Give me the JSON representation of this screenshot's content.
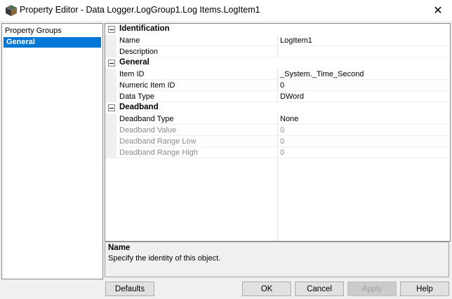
{
  "window": {
    "title": "Property Editor - Data Logger.LogGroup1.Log Items.LogItem1",
    "close_glyph": "✕"
  },
  "groups": {
    "header": "Property Groups",
    "selected": "General"
  },
  "grid": {
    "categories": [
      {
        "label": "Identification",
        "rows": [
          {
            "name": "Name",
            "value": "LogItem1",
            "disabled": false
          },
          {
            "name": "Description",
            "value": "",
            "disabled": false
          }
        ]
      },
      {
        "label": "General",
        "rows": [
          {
            "name": "Item ID",
            "value": "_System._Time_Second",
            "disabled": false
          },
          {
            "name": "Numeric Item ID",
            "value": "0",
            "disabled": false
          },
          {
            "name": "Data Type",
            "value": "DWord",
            "disabled": false
          }
        ]
      },
      {
        "label": "Deadband",
        "rows": [
          {
            "name": "Deadband Type",
            "value": "None",
            "disabled": false
          },
          {
            "name": "Deadband Value",
            "value": "0",
            "disabled": true
          },
          {
            "name": "Deadband Range Low",
            "value": "0",
            "disabled": true
          },
          {
            "name": "Deadband Range High",
            "value": "0",
            "disabled": true
          }
        ]
      }
    ]
  },
  "help": {
    "title": "Name",
    "text": "Specify the identity of this object."
  },
  "buttons": {
    "defaults": "Defaults",
    "ok": "OK",
    "cancel": "Cancel",
    "apply": "Apply",
    "help": "Help"
  }
}
